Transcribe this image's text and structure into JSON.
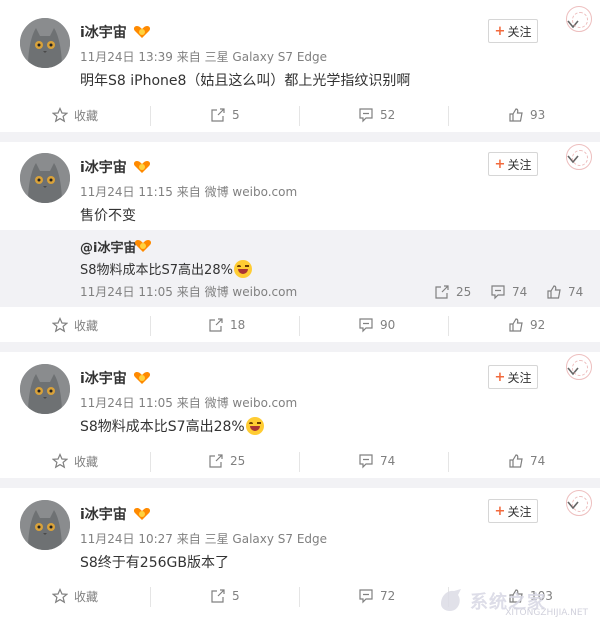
{
  "posts": [
    {
      "username": "i冰宇宙",
      "time": "11月24日 13:39",
      "via": "来自",
      "source": "三星 Galaxy S7 Edge",
      "text": "明年S8 iPhone8（姑且这么叫）都上光学指纹识别啊",
      "follow_label": "关注",
      "actions": {
        "favorite": "收藏",
        "repost": "5",
        "comment": "52",
        "like": "93"
      }
    },
    {
      "username": "i冰宇宙",
      "time": "11月24日 11:15",
      "via": "来自",
      "source": "微博 weibo.com",
      "text": "售价不变",
      "follow_label": "关注",
      "repost": {
        "author": "@i冰宇宙",
        "text": "S8物料成本比S7高出28%",
        "time": "11月24日 11:05",
        "via": "来自",
        "source": "微博 weibo.com",
        "repost": "25",
        "comment": "74",
        "like": "74"
      },
      "actions": {
        "favorite": "收藏",
        "repost": "18",
        "comment": "90",
        "like": "92"
      }
    },
    {
      "username": "i冰宇宙",
      "time": "11月24日 11:05",
      "via": "来自",
      "source": "微博 weibo.com",
      "text": "S8物料成本比S7高出28%",
      "follow_label": "关注",
      "actions": {
        "favorite": "收藏",
        "repost": "25",
        "comment": "74",
        "like": "74"
      }
    },
    {
      "username": "i冰宇宙",
      "time": "11月24日 10:27",
      "via": "来自",
      "source": "三星 Galaxy S7 Edge",
      "text": "S8终于有256GB版本了",
      "follow_label": "关注",
      "actions": {
        "favorite": "收藏",
        "repost": "5",
        "comment": "72",
        "like": "103"
      }
    }
  ],
  "watermark": {
    "text": "系统之家",
    "sub": "XITONGZHIJIA.NET"
  },
  "colors": {
    "accent": "#f26a3d",
    "meta": "#808080",
    "repost_bg": "#f2f2f5"
  },
  "icons": [
    "star-icon",
    "repost-icon",
    "comment-icon",
    "like-icon",
    "chevron-down-icon",
    "verified-badge-icon",
    "laugh-emoji-icon",
    "cat-avatar"
  ]
}
